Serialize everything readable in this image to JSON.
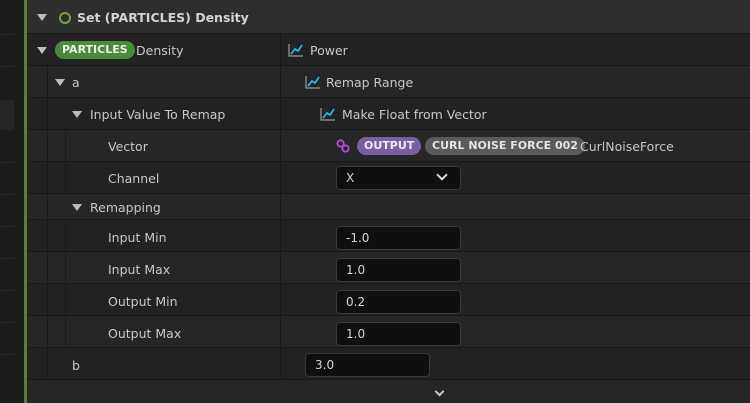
{
  "header": {
    "title": "Set (PARTICLES) Density"
  },
  "rows": {
    "density": {
      "tag": "PARTICLES",
      "label": "Density",
      "value": "Power"
    },
    "a": {
      "label": "a",
      "value": "Remap Range"
    },
    "input_value": {
      "label": "Input Value To Remap",
      "value": "Make Float from Vector"
    },
    "vector": {
      "label": "Vector",
      "tag_output": "OUTPUT",
      "tag_source": "CURL NOISE FORCE 002",
      "value": "CurlNoiseForce"
    },
    "channel": {
      "label": "Channel",
      "value": "X"
    },
    "remapping": {
      "label": "Remapping"
    },
    "input_min": {
      "label": "Input Min",
      "value": "-1.0"
    },
    "input_max": {
      "label": "Input Max",
      "value": "1.0"
    },
    "output_min": {
      "label": "Output Min",
      "value": "0.2"
    },
    "output_max": {
      "label": "Output Max",
      "value": "1.0"
    },
    "b": {
      "label": "b",
      "value": "3.0"
    }
  },
  "colors": {
    "accent": "#5f7d33",
    "particles_pill": "#4b8a3d",
    "output_pill": "#7a5ea4",
    "source_pill": "#5a5a5a",
    "function_icon": "#3fa9e0"
  },
  "icons": {
    "header_ring": "circle-ring-icon",
    "function": "graph-line-icon",
    "link": "link-icon",
    "collapse": "triangle-down-icon"
  }
}
